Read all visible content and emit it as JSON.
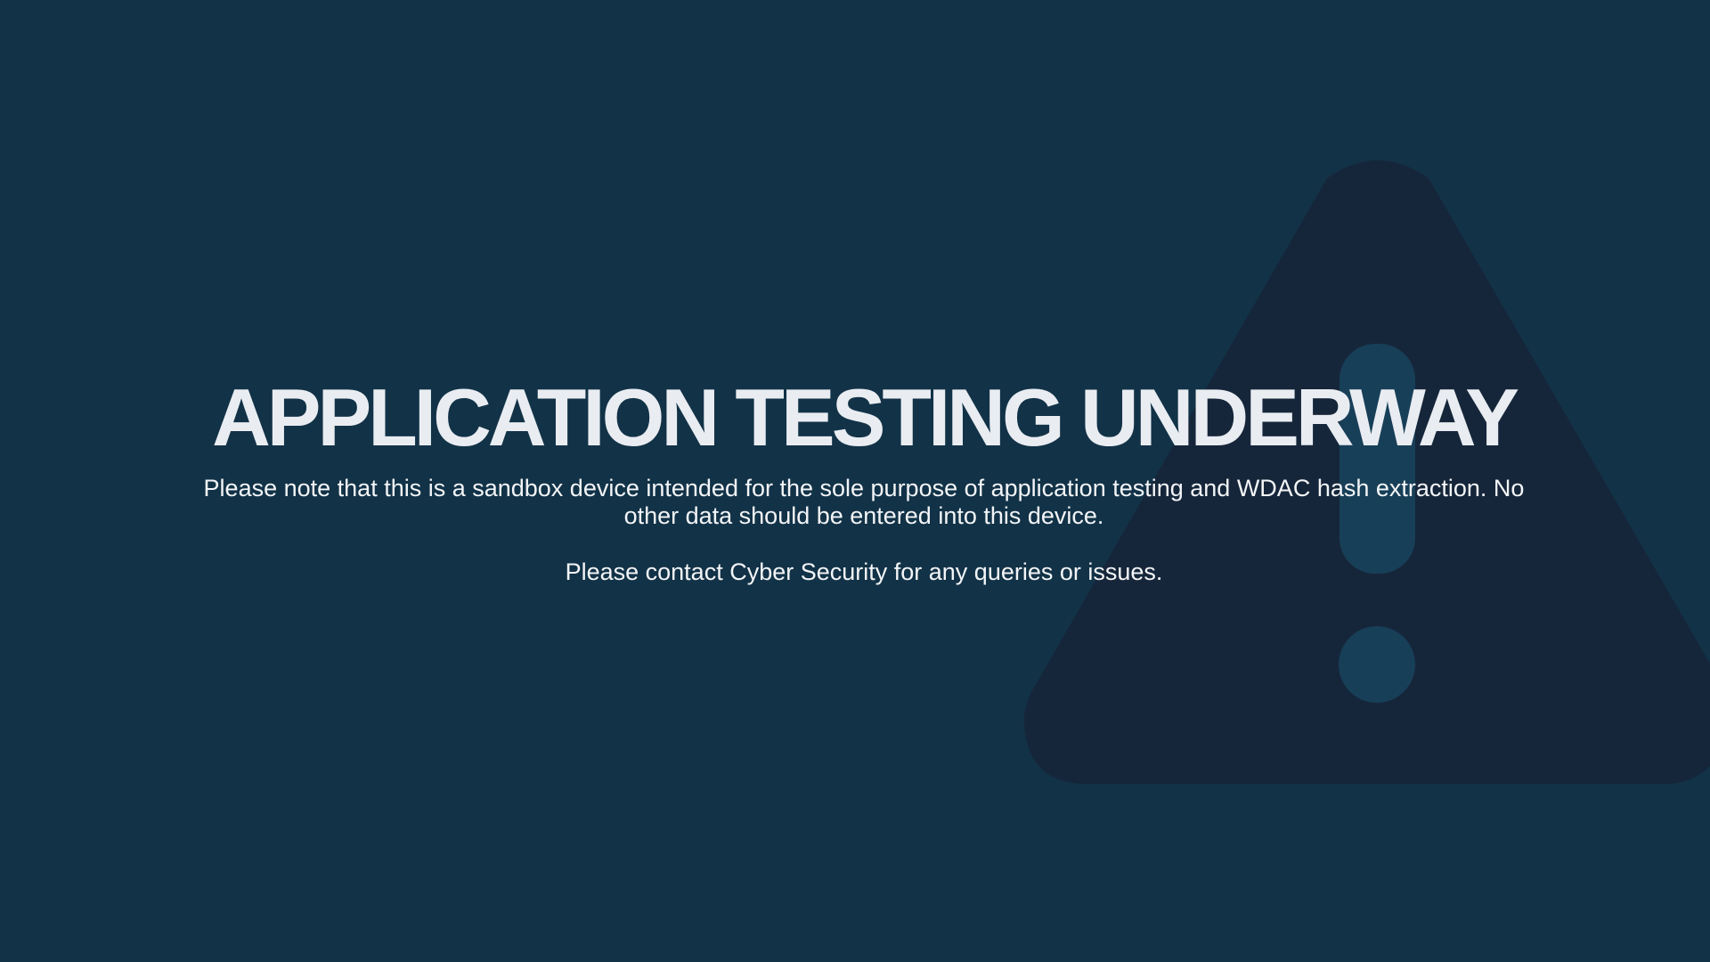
{
  "colors": {
    "background": "#123247",
    "warning_triangle": "#16263a",
    "warning_mark": "#183f58",
    "title_text": "#e9edf2",
    "body_text": "#f3f5f7"
  },
  "background_icon": "warning-triangle-icon",
  "title": "APPLICATION TESTING UNDERWAY",
  "notice": "Please note that this is a sandbox device intended for the sole purpose of application testing and WDAC hash extraction. No other data should be entered into this device.",
  "contact": "Please contact Cyber Security for any queries or issues."
}
